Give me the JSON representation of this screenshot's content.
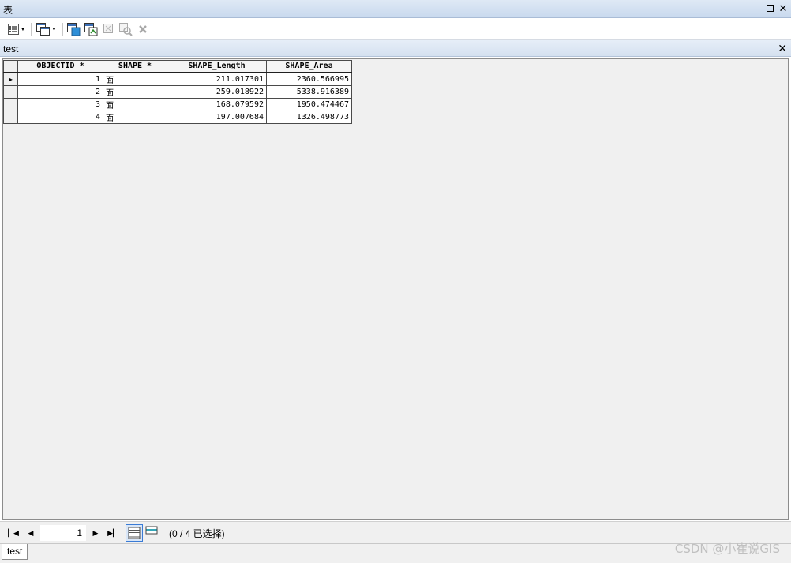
{
  "window": {
    "title": "表"
  },
  "toolbar": {
    "icons": [
      "table-options-icon",
      "related-tables-icon",
      "select-by-attributes-icon",
      "switch-selection-icon",
      "clear-selection-icon",
      "zoom-to-selected-icon",
      "delete-selected-icon"
    ]
  },
  "table": {
    "name": "test",
    "columns": [
      "OBJECTID *",
      "SHAPE *",
      "SHAPE_Length",
      "SHAPE_Area"
    ],
    "rows": [
      {
        "objectid": "1",
        "shape": "面",
        "length": "211.017301",
        "area": "2360.566995"
      },
      {
        "objectid": "2",
        "shape": "面",
        "length": "259.018922",
        "area": "5338.916389"
      },
      {
        "objectid": "3",
        "shape": "面",
        "length": "168.079592",
        "area": "1950.474467"
      },
      {
        "objectid": "4",
        "shape": "面",
        "length": "197.007684",
        "area": "1326.498773"
      }
    ]
  },
  "status": {
    "current_record": "1",
    "selection_text": "(0 / 4 已选择)"
  },
  "tabs": {
    "bottom_tab": "test"
  },
  "watermark": "CSDN @小崔说GIS",
  "colors": {
    "title_bar": "#c9d9ee",
    "grid_bg": "#f0f0f0",
    "active_view": "#3a7bd5"
  }
}
